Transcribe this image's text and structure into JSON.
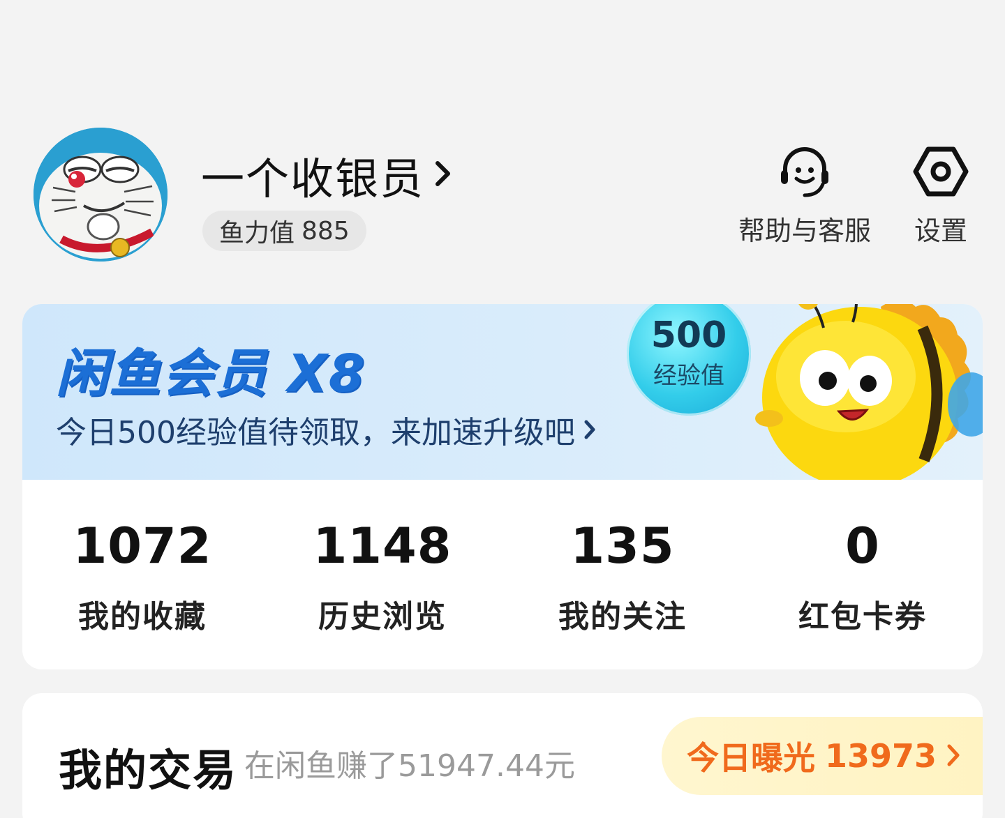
{
  "profile": {
    "name": "一个收银员",
    "fish_label": "鱼力值",
    "fish_value": "885"
  },
  "top_actions": {
    "help_label": "帮助与客服",
    "settings_label": "设置"
  },
  "member": {
    "title": "闲鱼会员 X8",
    "subtitle": "今日500经验值待领取，来加速升级吧",
    "bubble_value": "500",
    "bubble_unit": "经验值"
  },
  "stats": [
    {
      "value": "1072",
      "label": "我的收藏"
    },
    {
      "value": "1148",
      "label": "历史浏览"
    },
    {
      "value": "135",
      "label": "我的关注"
    },
    {
      "value": "0",
      "label": "红包卡券"
    }
  ],
  "trade": {
    "title": "我的交易",
    "earned": "在闲鱼赚了51947.44元",
    "exposure_label": "今日曝光",
    "exposure_value": "13973"
  },
  "colors": {
    "member_title": "#1c6fd6",
    "exposure_text": "#f06a1c",
    "page_bg": "#f3f3f3"
  },
  "icons": {
    "help": "headset-smile-icon",
    "settings": "hexagon-gear-icon",
    "chevron": "chevron-right-icon"
  }
}
